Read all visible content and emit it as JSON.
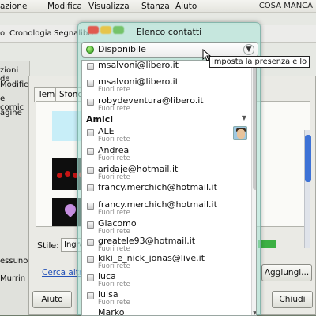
{
  "background_window": {
    "menu": [
      "azione",
      "Modifica",
      "Visualizza",
      "Stanza",
      "Aiuto"
    ],
    "title_right": "COSA MANCA",
    "toolbar": [
      "o",
      "Cronologia",
      "Segnalibri"
    ],
    "left_labels": [
      "zioni de",
      "Modifica",
      "e cornic",
      "agine"
    ],
    "bottom_left_labels": [
      "essuno",
      "Murrin"
    ]
  },
  "background_dialog": {
    "tabs": [
      "Tema",
      "Sfondo"
    ],
    "style_label": "Stile:",
    "style_value": "Ingra",
    "link": "Cerca altri s",
    "add_button": "Aggiungi...",
    "help_button": "Aiuto",
    "close_button": "Chiudi"
  },
  "contact_window": {
    "title": "Elenco contatti",
    "status": "Disponibile",
    "tooltip": "Imposta la presenza e lo stato",
    "contacts_top": [
      {
        "name": "msalvoni@libero.it",
        "status": ""
      },
      {
        "name": "msalvoni@libero.it",
        "status": "Fuori rete"
      },
      {
        "name": "robydeventura@libero.it",
        "status": "Fuori rete"
      }
    ],
    "group": "Amici",
    "contacts_group": [
      {
        "name": "ALE",
        "status": "Fuori rete"
      },
      {
        "name": "Andrea",
        "status": "Fuori rete"
      },
      {
        "name": "aridaje@hotmail.it",
        "status": "Fuori rete"
      },
      {
        "name": "francy.merchich@hotmail.it",
        "status": ""
      },
      {
        "name": "francy.merchich@hotmail.it",
        "status": "Fuori rete"
      },
      {
        "name": "Giacomo",
        "status": "Fuori rete"
      },
      {
        "name": "greatele93@hotmail.it",
        "status": "Fuori rete"
      },
      {
        "name": "kiki_e_nick_jonas@live.it",
        "status": "Fuori rete"
      },
      {
        "name": "luca",
        "status": "Fuori rete"
      },
      {
        "name": "luisa",
        "status": "Fuori rete"
      },
      {
        "name": "Marko",
        "status": ""
      }
    ]
  },
  "colors": {
    "status_available": "#3cb043",
    "link": "#2553b8",
    "offline_text": "#8a8a8a"
  }
}
